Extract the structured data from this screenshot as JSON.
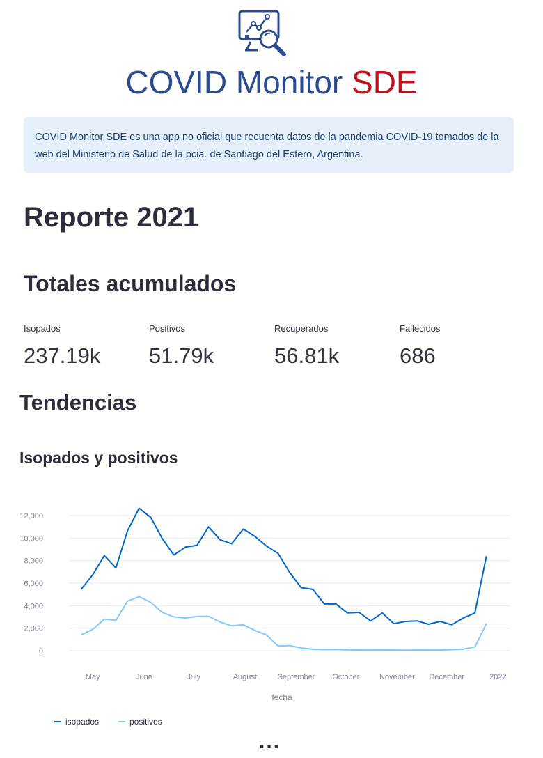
{
  "header": {
    "title_part1": "COVID Monitor",
    "title_part2": "SDE",
    "logo_icon": "monitor-chart-search-icon"
  },
  "info": {
    "text": "COVID Monitor SDE es una app no oficial que recuenta datos de la pandemia COVID-19 tomados de la web del Ministerio de Salud de la pcia. de Santiago del Estero, Argentina."
  },
  "report": {
    "title": "Reporte 2021"
  },
  "totals": {
    "title": "Totales acumulados",
    "metrics": [
      {
        "label": "Isopados",
        "value": "237.19k"
      },
      {
        "label": "Positivos",
        "value": "51.79k"
      },
      {
        "label": "Recuperados",
        "value": "56.81k"
      },
      {
        "label": "Fallecidos",
        "value": "686"
      }
    ]
  },
  "trends": {
    "title": "Tendencias",
    "subtitle": "Isopados y positivos"
  },
  "chart_data": {
    "type": "line",
    "title": "",
    "xlabel": "fecha",
    "ylabel": "",
    "ylim": [
      0,
      12000
    ],
    "yticks": [
      "0",
      "2,000",
      "4,000",
      "6,000",
      "8,000",
      "10,000",
      "12,000"
    ],
    "xticks": [
      "May",
      "June",
      "July",
      "August",
      "September",
      "October",
      "November",
      "December",
      "2022"
    ],
    "grid": true,
    "legend_position": "bottom-left",
    "x": [
      "2021-04-24",
      "2021-05-01",
      "2021-05-08",
      "2021-05-15",
      "2021-05-22",
      "2021-05-29",
      "2021-06-05",
      "2021-06-12",
      "2021-06-19",
      "2021-06-26",
      "2021-07-03",
      "2021-07-10",
      "2021-07-17",
      "2021-07-24",
      "2021-07-31",
      "2021-08-07",
      "2021-08-14",
      "2021-08-21",
      "2021-08-28",
      "2021-09-04",
      "2021-09-11",
      "2021-09-18",
      "2021-09-25",
      "2021-10-02",
      "2021-10-09",
      "2021-10-16",
      "2021-10-23",
      "2021-10-30",
      "2021-11-06",
      "2021-11-13",
      "2021-11-20",
      "2021-11-27",
      "2021-12-04",
      "2021-12-11",
      "2021-12-18",
      "2021-12-25",
      "2022-01-01"
    ],
    "series": [
      {
        "name": "isopados",
        "color": "#0068c9",
        "values": [
          5450,
          6750,
          8450,
          7350,
          10650,
          12650,
          11850,
          9950,
          8500,
          9200,
          9350,
          11000,
          9850,
          9500,
          10800,
          10150,
          9300,
          8650,
          6950,
          5600,
          5450,
          4150,
          4150,
          3350,
          3400,
          2650,
          3350,
          2400,
          2600,
          2650,
          2350,
          2600,
          2300,
          2900,
          3350,
          8400,
          null
        ]
      },
      {
        "name": "positivos",
        "color": "#83c9ff",
        "values": [
          1400,
          1900,
          2800,
          2700,
          4400,
          4800,
          4300,
          3400,
          3000,
          2900,
          3050,
          3050,
          2550,
          2200,
          2300,
          1800,
          1400,
          420,
          450,
          250,
          130,
          100,
          120,
          80,
          70,
          70,
          80,
          60,
          50,
          60,
          60,
          60,
          100,
          140,
          330,
          2400,
          null
        ]
      }
    ]
  }
}
